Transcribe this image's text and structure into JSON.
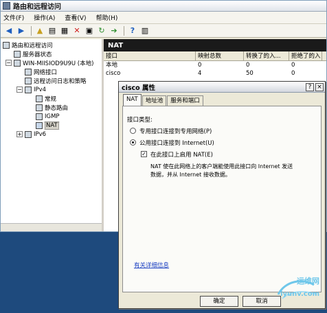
{
  "window": {
    "title": "路由和远程访问"
  },
  "menu": [
    "文件(F)",
    "操作(A)",
    "查看(V)",
    "帮助(H)"
  ],
  "tree": {
    "root": "路由和远程访问",
    "server_status": "服务器状态",
    "server": "WIN-MIISIOD9U9U (本地)",
    "net_interfaces": "网络接口",
    "logging": "远程访问日志和策略",
    "ipv4": "IPv4",
    "general": "常规",
    "static_routes": "静态路由",
    "igmp": "IGMP",
    "nat": "NAT",
    "ipv6": "IPv6"
  },
  "list": {
    "header": "NAT",
    "columns": [
      "接口",
      "映射总数",
      "转换了的入...",
      "拒绝了的入"
    ],
    "rows": [
      [
        "本地",
        "0",
        "0",
        "0"
      ],
      [
        "cisco",
        "4",
        "50",
        "0"
      ]
    ]
  },
  "dialog": {
    "title": "cisco 属性",
    "tabs": [
      "NAT",
      "地址池",
      "服务和端口"
    ],
    "iface_type_label": "接口类型:",
    "opt_private": "专用接口连接到专用网络(P)",
    "opt_public": "公用接口连接到 Internet(U)",
    "opt_enable_nat": "在此接口上启用 NAT(E)",
    "desc_line1": "NAT 使在此网络上的客户端能使用此接口向 Internet 发送",
    "desc_line2": "数据，并从 Internet 接收数据。",
    "help_link": "有关详细信息",
    "ok": "确定",
    "cancel": "取消",
    "close_glyph": "×",
    "help_glyph": "?"
  },
  "watermark": {
    "brand": "运维网",
    "site": "iyunv.com"
  },
  "colors": {
    "desktop": "#1e4a7d",
    "accent": "#1a3fc2"
  }
}
